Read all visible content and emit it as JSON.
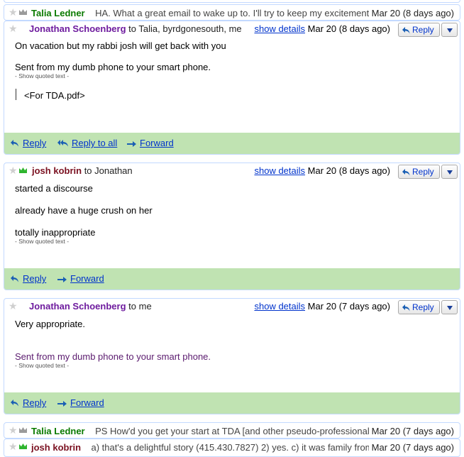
{
  "colors": {
    "border": "#c3d9ff",
    "footer": "#c0e3b2",
    "link": "#0033cc"
  },
  "top_row": {
    "sender": "Talia Ledner",
    "snippet": "HA. What a great email to wake up to. I'll try to keep my excitement to",
    "date": "Mar 20 (8 days ago)"
  },
  "message1": {
    "sender": "Jonathan Schoenberg",
    "to": "to Talia, byrdgonesouth, me",
    "show_details": "show details",
    "date": "Mar 20 (8 days ago)",
    "reply_label": "Reply",
    "body": [
      "On vacation but my rabbi josh will get back with you",
      "Sent from my dumb phone to your smart phone."
    ],
    "quoted": "- Show quoted text -",
    "attachment": "<For TDA.pdf>",
    "footer": {
      "reply": "Reply",
      "reply_all": "Reply to all",
      "forward": "Forward"
    }
  },
  "message2": {
    "sender": "josh kobrin",
    "to": "to Jonathan",
    "show_details": "show details",
    "date": "Mar 20 (8 days ago)",
    "reply_label": "Reply",
    "body": [
      "started a discourse",
      "already have a huge crush on her",
      "totally inappropriate"
    ],
    "quoted": "- Show quoted text -",
    "footer": {
      "reply": "Reply",
      "forward": "Forward"
    }
  },
  "message3": {
    "sender": "Jonathan Schoenberg",
    "to": "to me",
    "show_details": "show details",
    "date": "Mar 20 (7 days ago)",
    "reply_label": "Reply",
    "body": [
      "Very appropriate.",
      "Sent from my dumb phone to your smart phone."
    ],
    "quoted": "- Show quoted text -",
    "footer": {
      "reply": "Reply",
      "forward": "Forward"
    }
  },
  "row_talia2": {
    "sender": "Talia Ledner",
    "snippet": "PS How'd you get your start at TDA [and other pseudo-professional + social",
    "date": "Mar 20 (7 days ago)"
  },
  "row_josh2": {
    "sender": "josh kobrin",
    "snippet": "a) that's a delightful story (415.430.7827) 2) yes. c) it was family from",
    "date": "Mar 20 (7 days ago)"
  }
}
